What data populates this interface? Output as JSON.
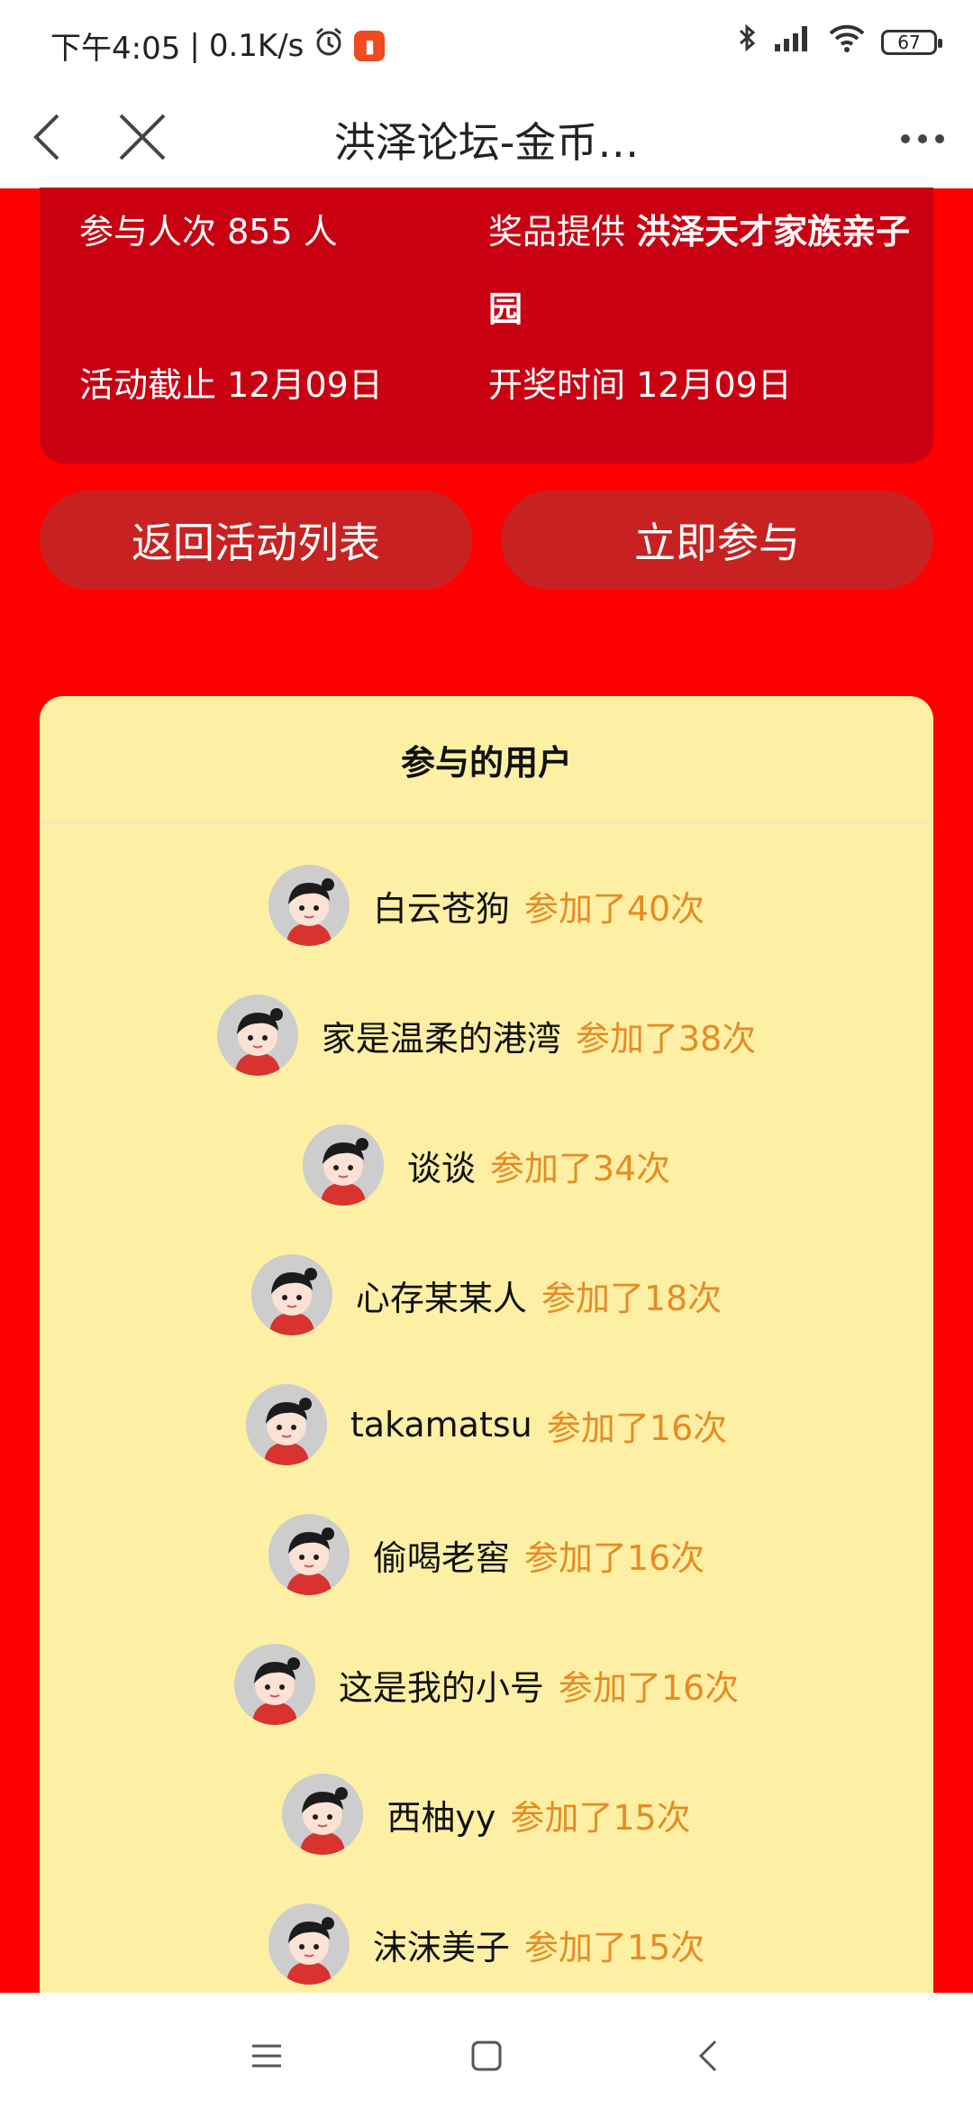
{
  "status_bar": {
    "time": "下午4:05",
    "speed": "0.1K/s",
    "battery": "67",
    "separator": "|"
  },
  "title_bar": {
    "title": "洪泽论坛-金币…"
  },
  "info": {
    "participants_label": "参与人次",
    "participants_value": "855 人",
    "prize_label": "奖品提供",
    "prize_value": "洪泽天才家族亲子园",
    "deadline_label": "活动截止",
    "deadline_value": "12月09日",
    "draw_label": "开奖时间",
    "draw_value": "12月09日"
  },
  "buttons": {
    "back_list": "返回活动列表",
    "join_now": "立即参与"
  },
  "users_panel": {
    "title": "参与的用户",
    "users": [
      {
        "name": "白云苍狗",
        "count": "参加了40次"
      },
      {
        "name": "家是温柔的港湾",
        "count": "参加了38次"
      },
      {
        "name": "谈谈",
        "count": "参加了34次"
      },
      {
        "name": "心存某某人",
        "count": "参加了18次"
      },
      {
        "name": "takamatsu",
        "count": "参加了16次"
      },
      {
        "name": "偷喝老窖",
        "count": "参加了16次"
      },
      {
        "name": "这是我的小号",
        "count": "参加了16次"
      },
      {
        "name": "西柚yy",
        "count": "参加了15次"
      },
      {
        "name": "沫沫美子",
        "count": "参加了15次"
      }
    ]
  },
  "colors": {
    "page_bg": "#ff0000",
    "card_bg": "#c80012",
    "button_bg": "#c72221",
    "panel_bg": "#fdf0a4",
    "count_text": "#e78b24"
  }
}
